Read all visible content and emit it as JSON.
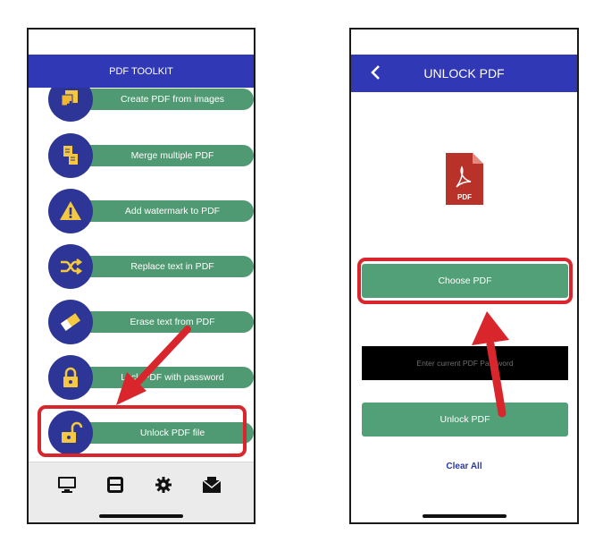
{
  "left_screen": {
    "title": "PDF TOOLKIT",
    "items": [
      {
        "label": "Create PDF from images",
        "icon": "image-add-icon"
      },
      {
        "label": "Merge multiple PDF",
        "icon": "merge-documents-icon"
      },
      {
        "label": "Add watermark to PDF",
        "icon": "warning-triangle-icon"
      },
      {
        "label": "Replace text in PDF",
        "icon": "shuffle-icon"
      },
      {
        "label": "Erase text from PDF",
        "icon": "eraser-icon"
      },
      {
        "label": "Lock PDF with password",
        "icon": "padlock-icon"
      },
      {
        "label": "Unlock PDF file",
        "icon": "unlocked-padlock-icon"
      }
    ],
    "bottom_nav": [
      {
        "icon": "monitor-icon"
      },
      {
        "icon": "scanner-icon"
      },
      {
        "icon": "gear-icon"
      },
      {
        "icon": "envelope-icon"
      }
    ]
  },
  "right_screen": {
    "title": "UNLOCK PDF",
    "back_icon": "chevron-left-icon",
    "file_icon_label": "PDF",
    "choose_pdf_label": "Choose PDF",
    "password_placeholder": "Enter current PDF Password",
    "password_value": "",
    "unlock_label": "Unlock PDF",
    "clear_all_label": "Clear All"
  },
  "colors": {
    "app_bar": "#3038b5",
    "button_green": "#52a078",
    "icon_circle": "#2d3697",
    "highlight_red": "#d9262d"
  }
}
